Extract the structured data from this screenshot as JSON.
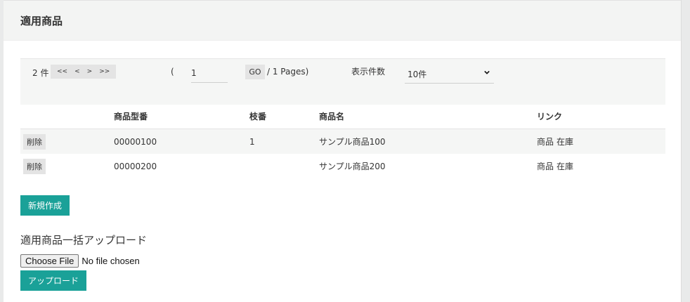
{
  "panel": {
    "title": "適用商品"
  },
  "pager": {
    "count": "2 件",
    "nav": [
      "<<",
      "<",
      ">",
      ">>"
    ],
    "paren": "(",
    "page_value": "1",
    "go_label": "GO",
    "pages_text": "/ 1 Pages)",
    "per_page_label": "表示件数",
    "per_page_value": "10件"
  },
  "table": {
    "headers": [
      "",
      "商品型番",
      "枝番",
      "商品名",
      "リンク"
    ],
    "rows": [
      {
        "delete": "削除",
        "code": "00000100",
        "branch": "1",
        "name": "サンプル商品100",
        "link1": "商品",
        "link2": "在庫"
      },
      {
        "delete": "削除",
        "code": "00000200",
        "branch": "",
        "name": "サンプル商品200",
        "link1": "商品",
        "link2": "在庫"
      }
    ]
  },
  "create_button": "新規作成",
  "upload": {
    "title": "適用商品一括アップロード",
    "choose_label": "Choose File",
    "no_file": "No file chosen",
    "upload_button": "アップロード"
  },
  "colors": {
    "accent": "#1aa198",
    "header_bg": "#f3f4f3"
  }
}
